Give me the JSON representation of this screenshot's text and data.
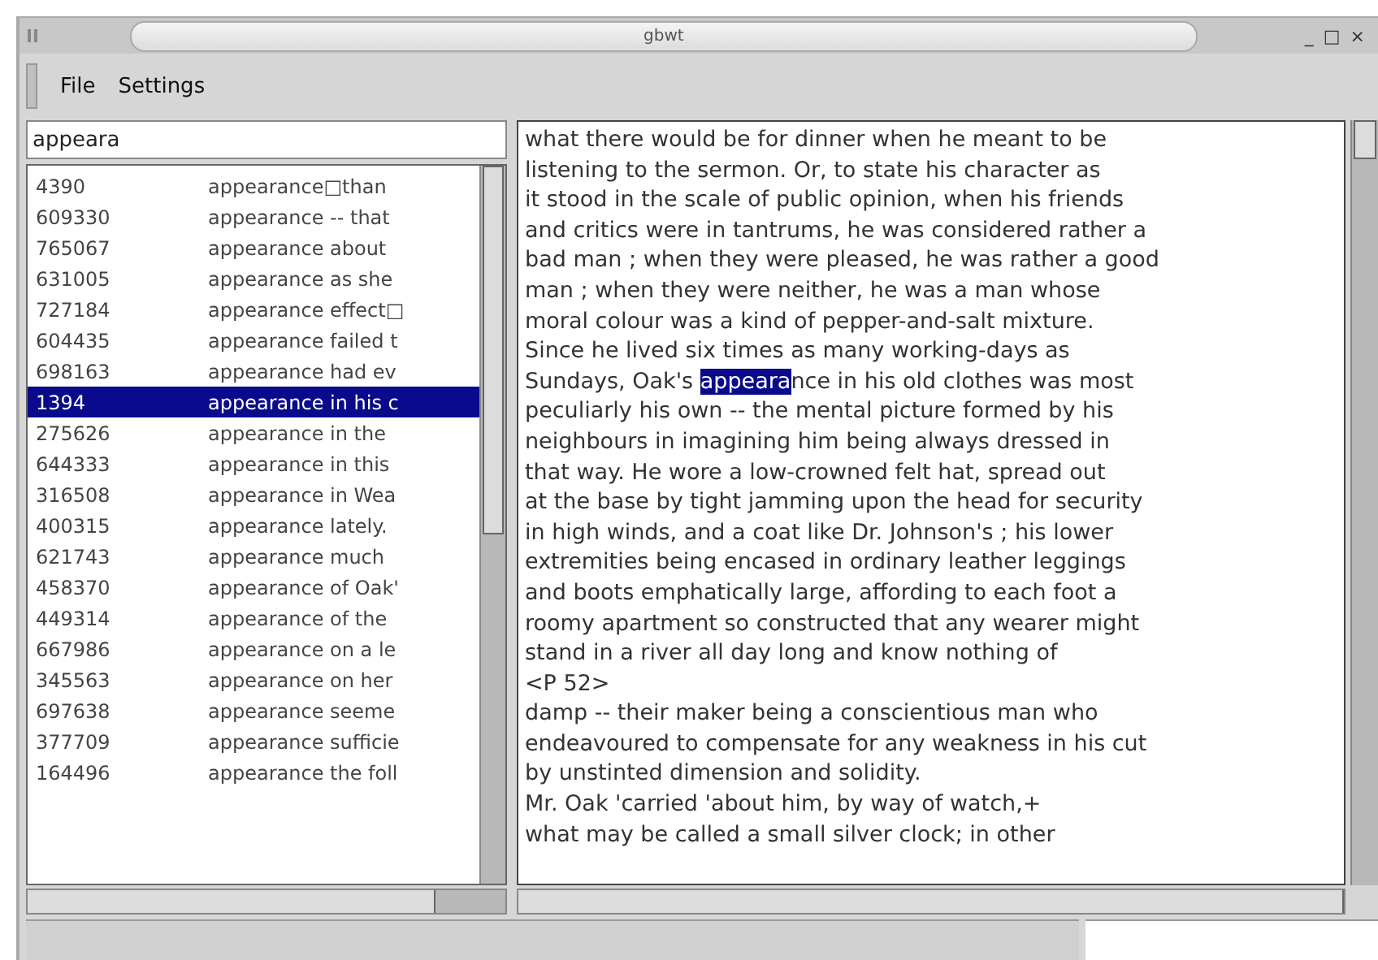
{
  "window": {
    "title": "gbwt",
    "controls": [
      "_",
      "□",
      "×"
    ]
  },
  "menu": [
    {
      "label": "File"
    },
    {
      "label": "Settings"
    }
  ],
  "search": {
    "value": "appeara"
  },
  "results": [
    {
      "id": "4390",
      "text": "appearance□than",
      "selected": false
    },
    {
      "id": "609330",
      "text": "appearance -- that",
      "selected": false
    },
    {
      "id": "765067",
      "text": "appearance about",
      "selected": false
    },
    {
      "id": "631005",
      "text": "appearance as she",
      "selected": false
    },
    {
      "id": "727184",
      "text": "appearance effect□",
      "selected": false
    },
    {
      "id": "604435",
      "text": "appearance failed t",
      "selected": false
    },
    {
      "id": "698163",
      "text": "appearance had ev",
      "selected": false
    },
    {
      "id": "1394",
      "text": "appearance in his c",
      "selected": true
    },
    {
      "id": "275626",
      "text": "appearance in the",
      "selected": false
    },
    {
      "id": "644333",
      "text": "appearance in this",
      "selected": false
    },
    {
      "id": "316508",
      "text": "appearance in Wea",
      "selected": false
    },
    {
      "id": "400315",
      "text": "appearance lately.",
      "selected": false
    },
    {
      "id": "621743",
      "text": "appearance much",
      "selected": false
    },
    {
      "id": "458370",
      "text": "appearance of Oak'",
      "selected": false
    },
    {
      "id": "449314",
      "text": "appearance of the",
      "selected": false
    },
    {
      "id": "667986",
      "text": "appearance on a le",
      "selected": false
    },
    {
      "id": "345563",
      "text": "appearance on her",
      "selected": false
    },
    {
      "id": "697638",
      "text": "appearance seeme",
      "selected": false
    },
    {
      "id": "377709",
      "text": "appearance sufficie",
      "selected": false
    },
    {
      "id": "164496",
      "text": "appearance the foll",
      "selected": false
    }
  ],
  "document": {
    "lines": [
      [
        {
          "text": "what there would be for dinner when he meant to be",
          "selected": false
        }
      ],
      [
        {
          "text": "listening to the sermon. Or, to state his character as",
          "selected": false
        }
      ],
      [
        {
          "text": "it stood in the scale of public opinion, when his friends",
          "selected": false
        }
      ],
      [
        {
          "text": "and critics were in tantrums, he was considered rather a",
          "selected": false
        }
      ],
      [
        {
          "text": "bad man ; when they were pleased, he was rather a good",
          "selected": false
        }
      ],
      [
        {
          "text": "man ; when they were neither, he was a man whose",
          "selected": false
        }
      ],
      [
        {
          "text": "moral colour was a kind of pepper-and-salt mixture.",
          "selected": false
        }
      ],
      [
        {
          "text": "Since he lived six times as many working-days as",
          "selected": false
        }
      ],
      [
        {
          "text": "Sundays, Oak's ",
          "selected": false
        },
        {
          "text": "appeara",
          "selected": true
        },
        {
          "text": "nce in his old clothes was most",
          "selected": false
        }
      ],
      [
        {
          "text": "peculiarly his own -- the mental picture formed by his",
          "selected": false
        }
      ],
      [
        {
          "text": "neighbours in imagining him being always dressed in",
          "selected": false
        }
      ],
      [
        {
          "text": "that way. He wore a low-crowned felt hat, spread out",
          "selected": false
        }
      ],
      [
        {
          "text": "at the base by tight jamming upon the head for security",
          "selected": false
        }
      ],
      [
        {
          "text": "in high winds, and a coat like Dr. Johnson's ; his lower",
          "selected": false
        }
      ],
      [
        {
          "text": "extremities being encased in ordinary leather leggings",
          "selected": false
        }
      ],
      [
        {
          "text": "and boots emphatically large, affording to each foot a",
          "selected": false
        }
      ],
      [
        {
          "text": "roomy apartment so constructed that any wearer might",
          "selected": false
        }
      ],
      [
        {
          "text": "stand in a river all day long and know nothing of",
          "selected": false
        }
      ],
      [
        {
          "text": "<P 52>",
          "selected": false
        }
      ],
      [
        {
          "text": "damp -- their maker being a conscientious man who",
          "selected": false
        }
      ],
      [
        {
          "text": "endeavoured to compensate for any weakness in his cut",
          "selected": false
        }
      ],
      [
        {
          "text": "by unstinted dimension and solidity.",
          "selected": false
        }
      ],
      [
        {
          "text": "Mr. Oak 'carried 'about him, by way of watch,+",
          "selected": false
        }
      ],
      [
        {
          "text": "what may be called a small silver clock; in other",
          "selected": false
        }
      ]
    ]
  }
}
